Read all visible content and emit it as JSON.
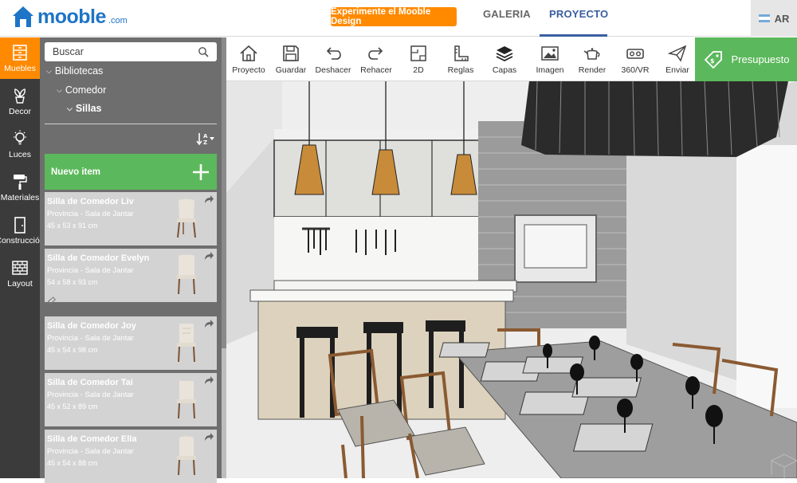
{
  "header": {
    "logo_text": "mooble",
    "logo_suffix": ".com",
    "cta_label": "Experimente el Mooble Design",
    "tabs": [
      {
        "label": "GALERIA",
        "active": false
      },
      {
        "label": "PROYECTO",
        "active": true
      }
    ],
    "language": "AR",
    "accent_color": "#ff8a00",
    "brand_color": "#1e74c6"
  },
  "rail": {
    "items": [
      {
        "label": "Muebles",
        "icon": "cabinet-icon",
        "active": true
      },
      {
        "label": "Decor",
        "icon": "plant-icon",
        "active": false
      },
      {
        "label": "Luces",
        "icon": "lightbulb-icon",
        "active": false
      },
      {
        "label": "Materiales",
        "icon": "paint-roller-icon",
        "active": false
      },
      {
        "label": "Construcción",
        "icon": "door-icon",
        "active": false
      },
      {
        "label": "Layout",
        "icon": "brick-wall-icon",
        "active": false
      }
    ]
  },
  "catalog": {
    "search_placeholder": "Buscar",
    "tree": [
      {
        "label": "Bibliotecas",
        "level": 0,
        "bold": false
      },
      {
        "label": "Comedor",
        "level": 1,
        "bold": false
      },
      {
        "label": "Sillas",
        "level": 2,
        "bold": true
      }
    ],
    "new_item_label": "Nuevo item",
    "products": [
      {
        "name": "Silla de Comedor Liv",
        "brand": "Provincia - Sala de Jantar",
        "dims": "45 x 53 x 91 cm"
      },
      {
        "name": "Silla de Comedor Evelyn",
        "brand": "Provincia - Sala de Jantar",
        "dims": "54 x 58 x 93 cm"
      },
      {
        "name": "Silla de Comedor Joy",
        "brand": "Provincia - Sala de Jantar",
        "dims": "45 x 54 x 98 cm"
      },
      {
        "name": "Silla de Comedor Tai",
        "brand": "Provincia - Sala de Jantar",
        "dims": "45 x 52 x 89 cm"
      },
      {
        "name": "Silla de Comedor Ella",
        "brand": "Provincia - Sala de Jantar",
        "dims": "45 x 54 x 88 cm"
      }
    ]
  },
  "toolbar": {
    "tools": [
      {
        "label": "Proyecto",
        "icon": "home-icon"
      },
      {
        "label": "Guardar",
        "icon": "save-icon"
      },
      {
        "label": "Deshacer",
        "icon": "undo-icon"
      },
      {
        "label": "Rehacer",
        "icon": "redo-icon"
      },
      {
        "label": "2D",
        "icon": "floorplan-2d-icon"
      },
      {
        "label": "Reglas",
        "icon": "ruler-icon"
      },
      {
        "label": "Capas",
        "icon": "layers-icon"
      },
      {
        "label": "Imagen",
        "icon": "image-icon"
      },
      {
        "label": "Render",
        "icon": "teapot-icon"
      },
      {
        "label": "360/VR",
        "icon": "vr-headset-icon"
      },
      {
        "label": "Enviar",
        "icon": "send-icon"
      }
    ],
    "budget_label": "Presupuesto",
    "budget_color": "#5cb85c"
  }
}
